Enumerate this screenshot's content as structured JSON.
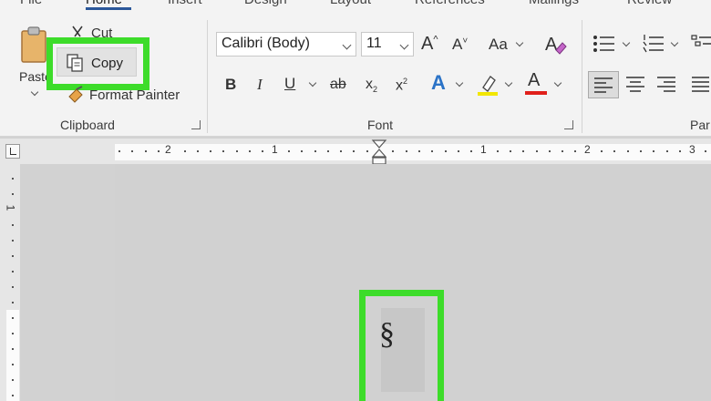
{
  "ribbon": {
    "tabs": [
      "File",
      "Home",
      "Insert",
      "Design",
      "Layout",
      "References",
      "Mailings",
      "Review"
    ],
    "clipboard": {
      "paste_label": "Paste",
      "cut_label": "Cut",
      "copy_label": "Copy",
      "format_painter_label": "Format Painter",
      "group_label": "Clipboard"
    },
    "font": {
      "font_name": "Calibri (Body)",
      "font_size": "11",
      "group_label": "Font",
      "bold": "B",
      "italic": "I",
      "underline": "U",
      "strike": "ab",
      "subscript_base": "x",
      "subscript_mark": "2",
      "superscript_base": "x",
      "superscript_mark": "2",
      "text_effects": "A",
      "font_color": "A",
      "change_case": "Aa",
      "grow_font": "A",
      "shrink_font": "A"
    },
    "paragraph": {
      "group_label": "Par"
    }
  },
  "ruler": {
    "numbers": [
      "2",
      "1",
      "1",
      "2",
      "3"
    ]
  },
  "vruler": {
    "numbers": [
      "1"
    ]
  },
  "document": {
    "paragraph_mark": "§"
  },
  "colors": {
    "highlight": "#3ddc2a",
    "font_color_bar": "#e0201b",
    "highlighter_bar": "#f2e600"
  }
}
